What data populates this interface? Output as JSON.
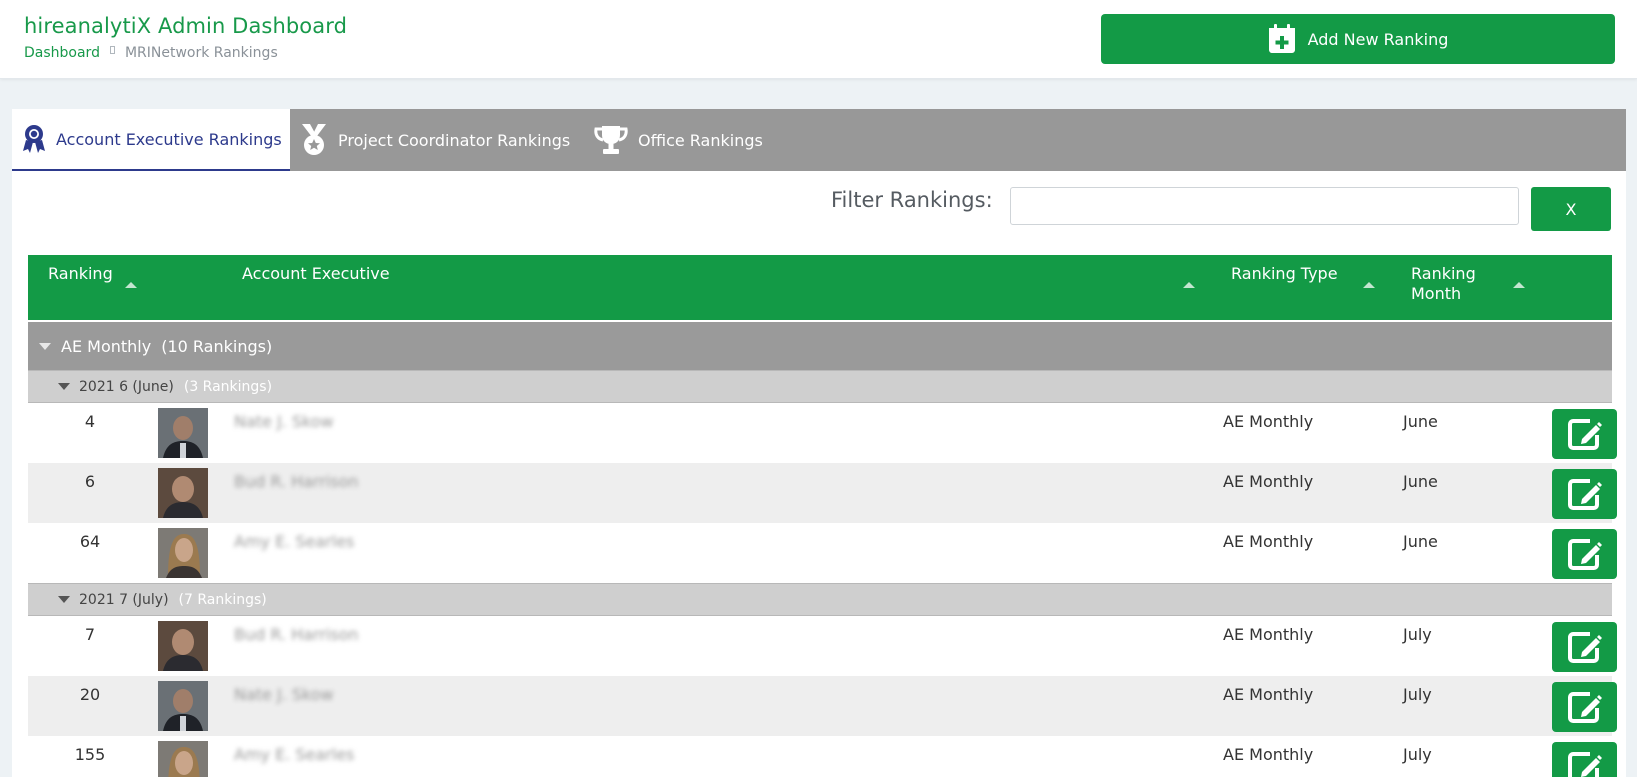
{
  "header": {
    "title": "hireanalytiX Admin Dashboard",
    "breadcrumb_home": "Dashboard",
    "breadcrumb_current": "MRINetwork Rankings",
    "add_button_label": "Add New Ranking"
  },
  "tabs": [
    {
      "label": "Account Executive Rankings",
      "icon": "ribbon-award-icon",
      "active": true
    },
    {
      "label": "Project Coordinator Rankings",
      "icon": "medal-icon",
      "active": false
    },
    {
      "label": "Office Rankings",
      "icon": "trophy-icon",
      "active": false
    }
  ],
  "filter": {
    "label": "Filter Rankings:",
    "value": "",
    "placeholder": "",
    "clear_label": "X"
  },
  "table": {
    "headers": [
      "Ranking",
      "Account Executive",
      "Ranking Type",
      "Ranking Month"
    ],
    "groups": [
      {
        "label": "AE Monthly",
        "count": "(10 Rankings)",
        "subgroups": [
          {
            "label": "2021 6 (June)",
            "count": "(3 Rankings)",
            "rows": [
              {
                "rank": "4",
                "name": "Nate J. Skow",
                "type": "AE Monthly",
                "month": "June"
              },
              {
                "rank": "6",
                "name": "Bud R. Harrison",
                "type": "AE Monthly",
                "month": "June"
              },
              {
                "rank": "64",
                "name": "Amy E. Searles",
                "type": "AE Monthly",
                "month": "June"
              }
            ]
          },
          {
            "label": "2021 7 (July)",
            "count": "(7 Rankings)",
            "rows": [
              {
                "rank": "7",
                "name": "Bud R. Harrison",
                "type": "AE Monthly",
                "month": "July"
              },
              {
                "rank": "20",
                "name": "Nate J. Skow",
                "type": "AE Monthly",
                "month": "July"
              },
              {
                "rank": "155",
                "name": "Amy E. Searles",
                "type": "AE Monthly",
                "month": "July"
              }
            ]
          }
        ]
      }
    ]
  },
  "colors": {
    "brand_green": "#139a46",
    "title_green": "#18994a",
    "tab_active": "#2d3a8c",
    "tabbar_gray": "#989898"
  }
}
